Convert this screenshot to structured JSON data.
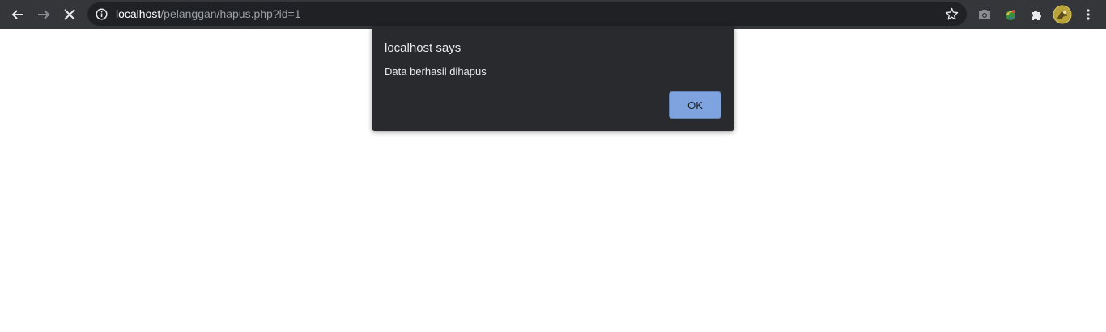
{
  "browser": {
    "url_host": "localhost",
    "url_path": "/pelanggan/hapus.php?id=1",
    "colors": {
      "toolbar": "#35363a",
      "omnibox": "#202124",
      "dialog": "#292a2d",
      "button": "#8ab4f8"
    }
  },
  "dialog": {
    "title": "localhost says",
    "message": "Data berhasil dihapus",
    "ok_label": "OK"
  }
}
